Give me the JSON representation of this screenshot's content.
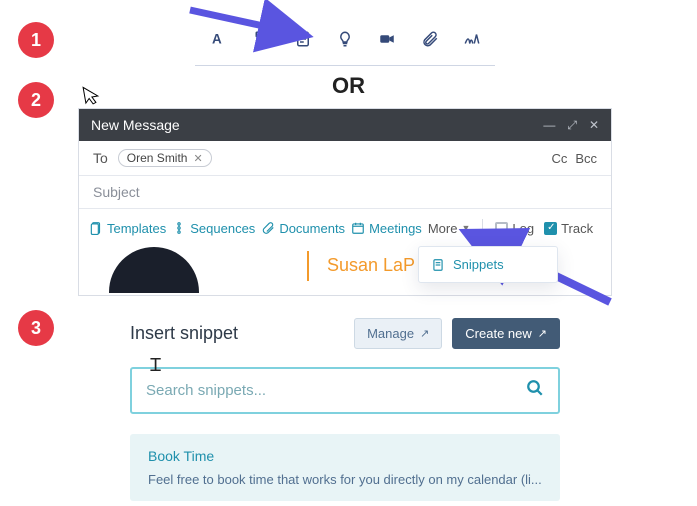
{
  "badges": {
    "one": "1",
    "two": "2",
    "three": "3"
  },
  "or_label": "OR",
  "toolbar1_icons": [
    "text-format",
    "snippets",
    "doc",
    "lightbulb",
    "video",
    "attach",
    "signature"
  ],
  "compose": {
    "title": "New Message",
    "to_label": "To",
    "recipient": "Oren Smith",
    "cc": "Cc",
    "bcc": "Bcc",
    "subject_placeholder": "Subject",
    "tools": {
      "templates": "Templates",
      "sequences": "Sequences",
      "documents": "Documents",
      "meetings": "Meetings",
      "more": "More",
      "log": "Log",
      "track": "Track"
    },
    "signature_name": "Susan LaP"
  },
  "dropdown": {
    "snippets": "Snippets"
  },
  "insert": {
    "title": "Insert snippet",
    "manage": "Manage",
    "create": "Create new",
    "search_placeholder": "Search snippets...",
    "card_title": "Book Time",
    "card_body": "Feel free to book time that works for you directly on my calendar (li..."
  }
}
